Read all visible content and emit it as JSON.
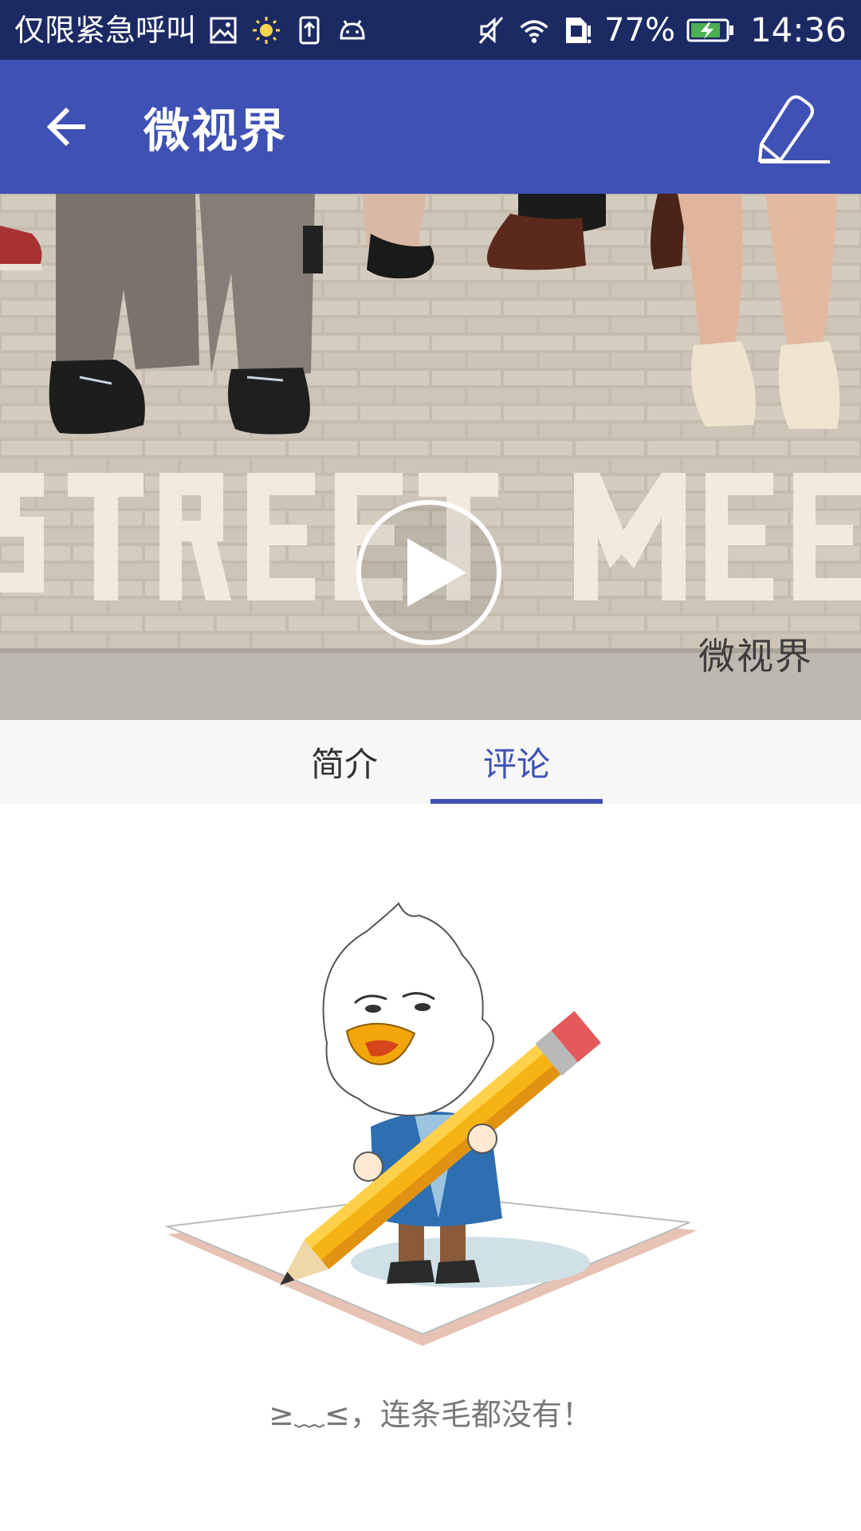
{
  "status_bar": {
    "carrier": "仅限紧急呼叫",
    "battery": "77%",
    "time": "14:36",
    "icons": [
      "gallery-icon",
      "sun-icon",
      "upload-icon",
      "android-icon",
      "mute-icon",
      "wifi-icon",
      "sim-alert-icon",
      "battery-charging-icon"
    ]
  },
  "app_bar": {
    "title": "微视界",
    "back_icon": "arrow-left-icon",
    "action_icon": "edit-pen-icon"
  },
  "video": {
    "watermark": "微视界",
    "play_icon": "play-icon"
  },
  "tabs": [
    {
      "label": "简介",
      "active": false
    },
    {
      "label": "评论",
      "active": true
    }
  ],
  "empty_state": {
    "message": "≥﹏≤，连条毛都没有！",
    "illustration": "bird-holding-pencil"
  },
  "colors": {
    "primary": "#3f51b5",
    "status_bar": "#1c2a63",
    "tab_bar_bg": "#f7f7f7",
    "empty_text": "#777777"
  }
}
